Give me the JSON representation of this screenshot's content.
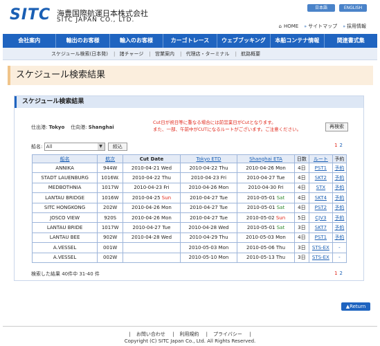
{
  "header": {
    "logo": "SITC",
    "company_jp": "海豊国際航運日本株式会社",
    "company_en": "SITC JAPAN CO., LTD.",
    "lang_buttons": [
      "日本語",
      "ENGLISH"
    ],
    "links": [
      "HOME",
      "サイトマップ",
      "採用情報"
    ]
  },
  "nav": [
    "会社案内",
    "輸出のお客様",
    "輸入のお客様",
    "カーゴトレース",
    "ウェブブッキング",
    "本船コンテナ情報",
    "関連書式集"
  ],
  "subnav": [
    "スケジュール検索(日本発)",
    "諸チャージ",
    "営業案内",
    "代理店・ターミナル",
    "航路概要"
  ],
  "page_title": "スケジュール検索結果",
  "panel": {
    "heading": "スケジュール検索結果",
    "ports": {
      "pol_label": "仕出港:",
      "pol": "Tokyo",
      "pod_label": "仕向港:",
      "pod": "Shanghai"
    },
    "notice_line1": "Cut日が祝日等に重なる場合には前営業日がCutとなります。",
    "notice_line2": "また、一部、午前中がCUTになるルートがございます。ご注意ください。",
    "research_label": "再検索",
    "ship_label": "船名:",
    "ship_select": "All",
    "filter_label": "絞込",
    "pages": [
      "1",
      "2"
    ],
    "columns": [
      "船名",
      "航次",
      "Cut Date",
      "Tokyo ETD",
      "Shanghai ETA",
      "日数",
      "ルート",
      "予約"
    ],
    "rows": [
      [
        "ANNIKA",
        "944W",
        "2010-04-21 Wed",
        "2010-04-22 Thu",
        "2010-04-26 Mon",
        "4日",
        "PST1",
        "予約"
      ],
      [
        "STADT LAUENBURG",
        "1016W.",
        "2010-04-22 Thu",
        "2010-04-23 Fri",
        "2010-04-27 Tue",
        "4日",
        "SKT2",
        "予約"
      ],
      [
        "MEDBOTHNIA",
        "1017W",
        "2010-04-23 Fri",
        "2010-04-26 Mon",
        "2010-04-30 Fri",
        "4日",
        "STX",
        "予約"
      ],
      [
        "LANTAU BRIDGE",
        "1016W",
        "2010-04-25 Sun",
        "2010-04-27 Tue",
        "2010-05-01 Sat",
        "4日",
        "SKT4",
        "予約"
      ],
      [
        "SITC HONGKONG",
        "202W",
        "2010-04-26 Mon",
        "2010-04-27 Tue",
        "2010-05-01 Sat",
        "4日",
        "PST2",
        "予約"
      ],
      [
        "JOSCO VIEW",
        "920S",
        "2010-04-26 Mon",
        "2010-04-27 Tue",
        "2010-05-02 Sun",
        "5日",
        "CJV3",
        "予約"
      ],
      [
        "LANTAU BRIDE",
        "1017W",
        "2010-04-27 Tue",
        "2010-04-28 Wed",
        "2010-05-01 Sat",
        "3日",
        "SKT7",
        "予約"
      ],
      [
        "LANTAU BEE",
        "902W",
        "2010-04-28 Wed",
        "2010-04-29 Thu",
        "2010-05-03 Mon",
        "4日",
        "PST1",
        "予約"
      ],
      [
        "A.VESSEL",
        "001W",
        "",
        "2010-05-03 Mon",
        "2010-05-06 Thu",
        "3日",
        "STS-EX",
        "-"
      ],
      [
        "A.VESSEL",
        "002W",
        "",
        "2010-05-10 Mon",
        "2010-05-13 Thu",
        "3日",
        "STS-EX",
        "-"
      ]
    ],
    "result_text": "検索した結果 40件中 31-40 件"
  },
  "return_label": "Return",
  "footer": {
    "links": [
      "お問い合わせ",
      "利用規約",
      "プライバシー"
    ],
    "copyright": "Copyright (C) SITC Japan Co., Ltd.  All Rights Reserved."
  }
}
